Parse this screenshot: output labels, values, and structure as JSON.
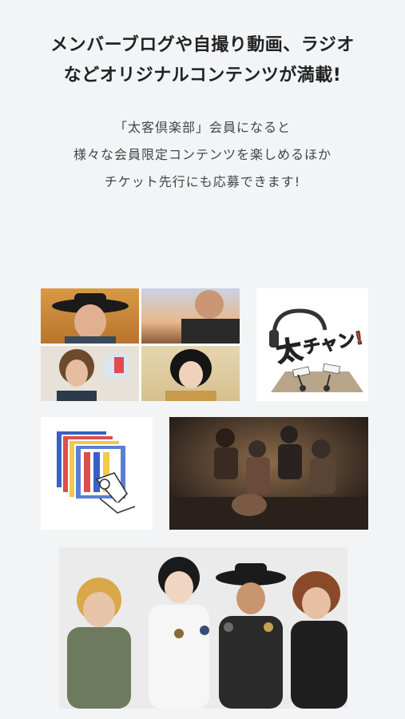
{
  "headline": {
    "line1": "メンバーブログや自撮り動画、ラジオ",
    "line2": "などオリジナルコンテンツが満載!"
  },
  "description": {
    "line1": "「太客倶楽部」会員になると",
    "line2": "様々な会員限定コンテンツを楽しめるほか",
    "line3": "チケット先行にも応募できます!"
  },
  "radio_logo": {
    "text_big": "太",
    "text_small": "チャン!"
  },
  "colors": {
    "background": "#f3f4f6",
    "radio_red": "#d83a2a",
    "tile_white": "#ffffff"
  }
}
